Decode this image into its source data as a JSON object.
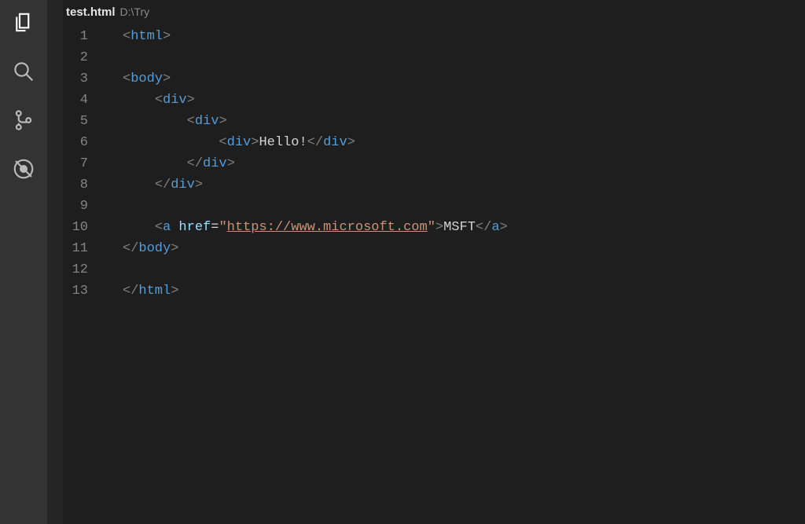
{
  "activityBar": {
    "explorer": "Explorer",
    "search": "Search",
    "scm": "Source Control",
    "debug": "Debug"
  },
  "tab": {
    "fileName": "test.html",
    "filePath": "D:\\Try"
  },
  "code": {
    "lineNumbers": [
      "1",
      "2",
      "3",
      "4",
      "5",
      "6",
      "7",
      "8",
      "9",
      "10",
      "11",
      "12",
      "13"
    ],
    "lang": "html",
    "s": {
      "lt": "<",
      "gt": ">",
      "sl": "/",
      "html": "html",
      "body": "body",
      "div": "div",
      "a": "a",
      "href": "href",
      "eq": "=",
      "q": "\"",
      "url": "https://www.microsoft.com",
      "hello": "Hello!",
      "msft": "MSFT"
    },
    "indent": {
      "i1": "    ",
      "i2": "        ",
      "i3": "            ",
      "i4": "                "
    }
  }
}
